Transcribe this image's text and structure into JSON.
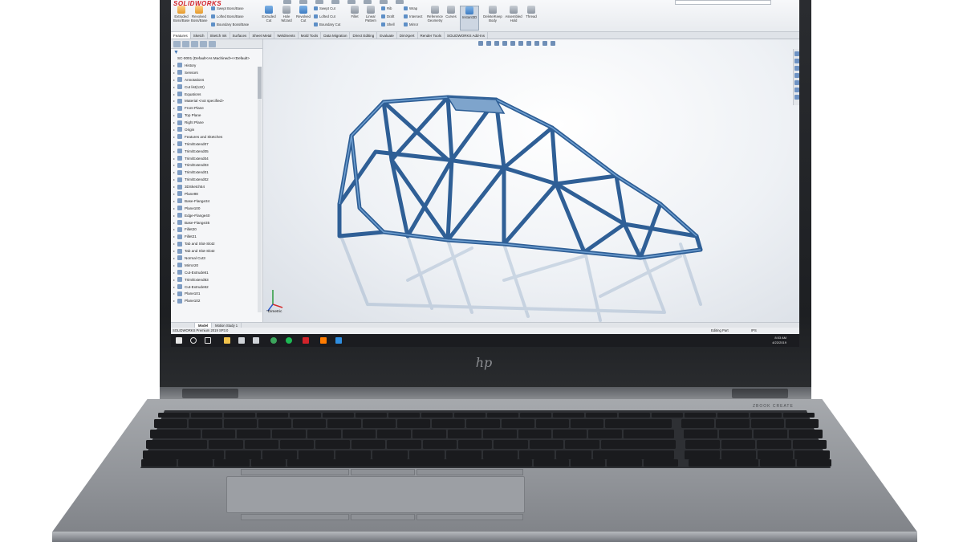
{
  "app": {
    "logo": "SOLIDWORKS",
    "colors": {
      "accent": "#d2232a",
      "frame_blue": "#2f5f96",
      "taskbar": "#1b1c20"
    }
  },
  "ribbon": {
    "tools": [
      {
        "label": "Extruded Boss/Base",
        "icon": "extruded-boss-icon"
      },
      {
        "label": "Revolved Boss/Base",
        "icon": "revolved-boss-icon"
      },
      {
        "label": "Swept Boss/Base",
        "icon": "swept-boss-icon"
      },
      {
        "label": "Lofted Boss/Base",
        "icon": "lofted-boss-icon"
      },
      {
        "label": "Boundary Boss/Base",
        "icon": "boundary-boss-icon"
      },
      {
        "label": "Extruded Cut",
        "icon": "extruded-cut-icon"
      },
      {
        "label": "Hole Wizard",
        "icon": "hole-wizard-icon"
      },
      {
        "label": "Revolved Cut",
        "icon": "revolved-cut-icon"
      },
      {
        "label": "Swept Cut",
        "icon": "swept-cut-icon"
      },
      {
        "label": "Lofted Cut",
        "icon": "lofted-cut-icon"
      },
      {
        "label": "Boundary Cut",
        "icon": "boundary-cut-icon"
      },
      {
        "label": "Fillet",
        "icon": "fillet-icon"
      },
      {
        "label": "Linear Pattern",
        "icon": "linear-pattern-icon"
      },
      {
        "label": "Rib",
        "icon": "rib-icon"
      },
      {
        "label": "Draft",
        "icon": "draft-icon"
      },
      {
        "label": "Shell",
        "icon": "shell-icon"
      },
      {
        "label": "Wrap",
        "icon": "wrap-icon"
      },
      {
        "label": "Intersect",
        "icon": "intersect-icon"
      },
      {
        "label": "Mirror",
        "icon": "mirror-icon"
      },
      {
        "label": "Reference Geometry",
        "icon": "reference-geometry-icon"
      },
      {
        "label": "Curves",
        "icon": "curves-icon"
      },
      {
        "label": "Instant3D",
        "icon": "instant3d-icon"
      },
      {
        "label": "Delete/Keep Body",
        "icon": "delete-body-icon"
      },
      {
        "label": "Assembled Hold",
        "icon": "assembled-hold-icon"
      },
      {
        "label": "Thread",
        "icon": "thread-icon"
      }
    ]
  },
  "command_tabs": [
    "Features",
    "Sketch",
    "Sketch Ink",
    "Surfaces",
    "Sheet Metal",
    "Weldments",
    "Mold Tools",
    "Data Migration",
    "Direct Editing",
    "Evaluate",
    "DimXpert",
    "Render Tools",
    "SOLIDWORKS Add-Ins"
  ],
  "feature_tree": {
    "root": "SC-0001 (Default<As Machined><<Default>",
    "items": [
      "History",
      "Sensors",
      "Annotations",
      "Cut list(122)",
      "Equations",
      "Material <not specified>",
      "Front Plane",
      "Top Plane",
      "Right Plane",
      "Origin",
      "Features and Sketches",
      "Trim/Extend07",
      "Trim/Extend05",
      "Trim/Extend04",
      "Trim/Extend03",
      "Trim/Extend01",
      "Trim/Extend02",
      "3DSketch54",
      "Plane98",
      "Base-Flange34",
      "Plane100",
      "Edge-Flange40",
      "Base-Flange35",
      "Fillet20",
      "Fillet21",
      "Tab and Slot-Slot2",
      "Tab and Slot-Slot2",
      "Normal Cut3",
      "Mirror20",
      "Cut-Extrude81",
      "Trim/Extend83",
      "Cut-Extrude82",
      "Plane101",
      "Plane102"
    ]
  },
  "viewport": {
    "view_label": "*Dimetric"
  },
  "bottom_tabs": [
    "Model",
    "Motion Study 1"
  ],
  "status": {
    "version": "SOLIDWORKS Premium 2019 SP3.0",
    "mode": "Editing Part",
    "units": "IPS"
  },
  "taskbar": {
    "icons": [
      "start-icon",
      "search-icon",
      "task-view-icon",
      "file-explorer-icon",
      "store-icon",
      "mail-icon",
      "chrome-icon",
      "spotify-icon",
      "solidworks-icon",
      "illustrator-icon",
      "edge-icon"
    ],
    "time": "8:53 AM",
    "date": "4/22/2019"
  },
  "laptop": {
    "brand": "hp",
    "series_text": "ZBOOK CREATE"
  }
}
